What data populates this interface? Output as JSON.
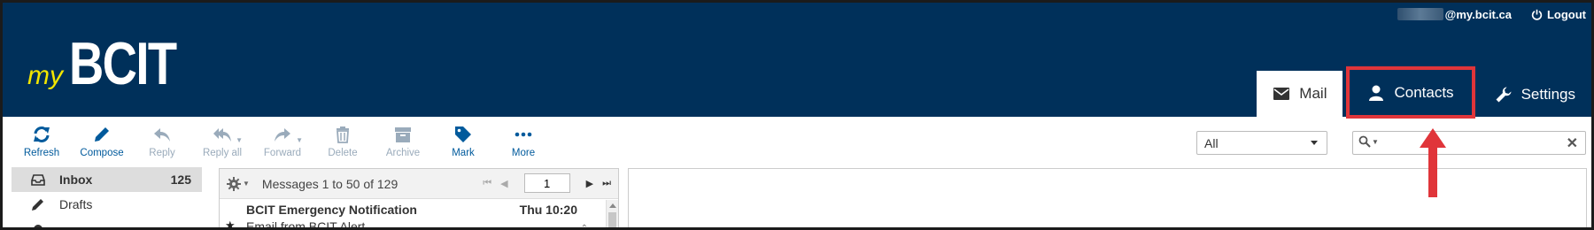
{
  "header": {
    "logo_my": "my",
    "logo_bcit": "BCIT",
    "user_domain": "@my.bcit.ca",
    "logout_label": "Logout",
    "tabs": [
      {
        "label": "Mail",
        "icon": "envelope-icon",
        "active": true
      },
      {
        "label": "Contacts",
        "icon": "person-icon",
        "active": false,
        "highlighted": true
      },
      {
        "label": "Settings",
        "icon": "wrench-icon",
        "active": false
      }
    ]
  },
  "toolbar": {
    "buttons": [
      {
        "label": "Refresh",
        "icon": "refresh-icon",
        "enabled": true
      },
      {
        "label": "Compose",
        "icon": "pencil-icon",
        "enabled": true
      },
      {
        "label": "Reply",
        "icon": "reply-icon",
        "enabled": false
      },
      {
        "label": "Reply all",
        "icon": "reply-all-icon",
        "enabled": false
      },
      {
        "label": "Forward",
        "icon": "forward-icon",
        "enabled": false
      },
      {
        "label": "Delete",
        "icon": "trash-icon",
        "enabled": false
      },
      {
        "label": "Archive",
        "icon": "archive-icon",
        "enabled": false
      },
      {
        "label": "Mark",
        "icon": "tag-icon",
        "enabled": true
      },
      {
        "label": "More",
        "icon": "ellipsis-icon",
        "enabled": true
      }
    ],
    "filter_value": "All",
    "search_placeholder": ""
  },
  "folders": [
    {
      "label": "Inbox",
      "count": "125",
      "icon": "inbox-icon",
      "active": true
    },
    {
      "label": "Drafts",
      "count": "",
      "icon": "pencil-icon",
      "active": false
    }
  ],
  "message_list": {
    "summary": "Messages 1 to 50 of 129",
    "page_number": "1",
    "messages": [
      {
        "from": "BCIT Emergency Notification",
        "date": "Thu 10:20",
        "subject": "Email from BCIT Alert",
        "flagged": true
      }
    ]
  },
  "colors": {
    "header_bg": "#00305a",
    "logo_my": "#f2e600",
    "accent": "#005a9c",
    "highlight": "#e0353a"
  }
}
